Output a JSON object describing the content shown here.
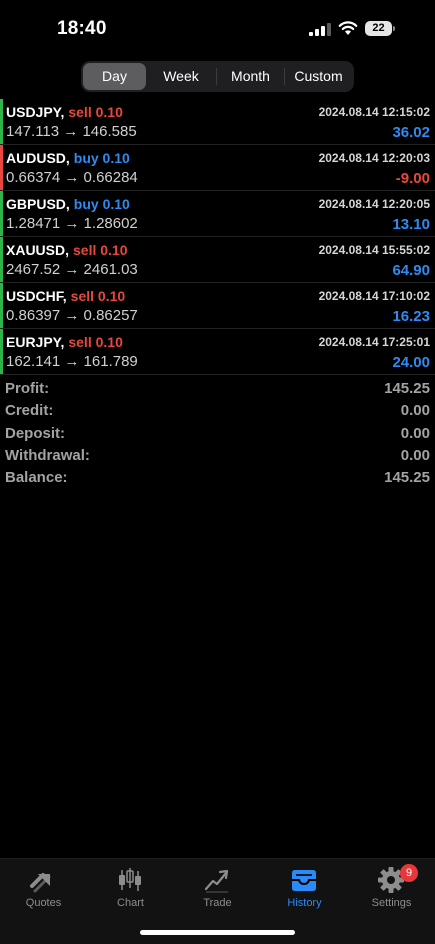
{
  "status_bar": {
    "time": "18:40",
    "battery": "22"
  },
  "periods": [
    "Day",
    "Week",
    "Month",
    "Custom"
  ],
  "active_period": "Day",
  "deals": [
    {
      "symbol": "USDJPY",
      "type": "sell 0.10",
      "side": "sell",
      "time": "2024.08.14 12:15:02",
      "prices": "147.113 → 146.585",
      "profit": "36.02",
      "profit_sign": "positive"
    },
    {
      "symbol": "AUDUSD",
      "type": "buy 0.10",
      "side": "buy",
      "time": "2024.08.14 12:20:03",
      "prices": "0.66374 → 0.66284",
      "profit": "-9.00",
      "profit_sign": "negative"
    },
    {
      "symbol": "GBPUSD",
      "type": "buy 0.10",
      "side": "buy",
      "time": "2024.08.14 12:20:05",
      "prices": "1.28471 → 1.28602",
      "profit": "13.10",
      "profit_sign": "positive"
    },
    {
      "symbol": "XAUUSD",
      "type": "sell 0.10",
      "side": "sell",
      "time": "2024.08.14 15:55:02",
      "prices": "2467.52 → 2461.03",
      "profit": "64.90",
      "profit_sign": "positive"
    },
    {
      "symbol": "USDCHF",
      "type": "sell 0.10",
      "side": "sell",
      "time": "2024.08.14 17:10:02",
      "prices": "0.86397 → 0.86257",
      "profit": "16.23",
      "profit_sign": "positive"
    },
    {
      "symbol": "EURJPY",
      "type": "sell 0.10",
      "side": "sell",
      "time": "2024.08.14 17:25:01",
      "prices": "162.141 → 161.789",
      "profit": "24.00",
      "profit_sign": "positive"
    }
  ],
  "summary": [
    {
      "label": "Profit:",
      "value": "145.25"
    },
    {
      "label": "Credit:",
      "value": "0.00"
    },
    {
      "label": "Deposit:",
      "value": "0.00"
    },
    {
      "label": "Withdrawal:",
      "value": "0.00"
    },
    {
      "label": "Balance:",
      "value": "145.25"
    }
  ],
  "tabs": [
    {
      "label": "Quotes",
      "icon": "quotes-icon"
    },
    {
      "label": "Chart",
      "icon": "candlestick-icon"
    },
    {
      "label": "Trade",
      "icon": "trade-icon"
    },
    {
      "label": "History",
      "icon": "inbox-icon"
    },
    {
      "label": "Settings",
      "icon": "gear-icon",
      "badge": "9"
    }
  ],
  "active_tab": "History",
  "colors": {
    "sell": "#e8473f",
    "buy": "#2f8bf0",
    "positive_profit": "#2f8bf0",
    "negative_profit": "#e8473f",
    "profit_bar": "#2db54a",
    "loss_bar": "#e8473f",
    "accent": "#2a8af6"
  }
}
